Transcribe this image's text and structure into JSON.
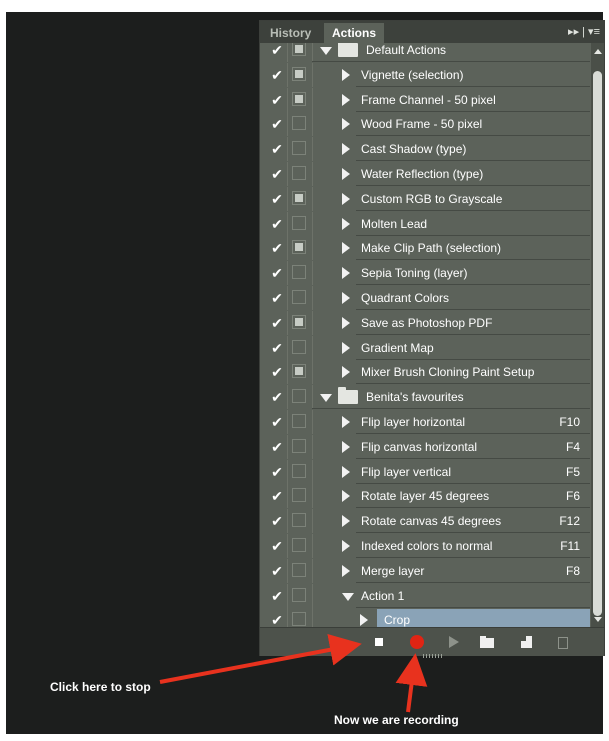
{
  "tabs": [
    {
      "label": "History",
      "active": false
    },
    {
      "label": "Actions",
      "active": true
    }
  ],
  "panel_menu": "▸▸ | ▾≡",
  "rows": [
    {
      "type": "set",
      "label": "Default Actions",
      "dialog": true,
      "expanded": true,
      "key": ""
    },
    {
      "type": "action",
      "label": "Vignette (selection)",
      "dialog": true,
      "key": ""
    },
    {
      "type": "action",
      "label": "Frame Channel - 50 pixel",
      "dialog": true,
      "key": ""
    },
    {
      "type": "action",
      "label": "Wood Frame - 50 pixel",
      "dialog": false,
      "key": ""
    },
    {
      "type": "action",
      "label": "Cast Shadow (type)",
      "dialog": false,
      "key": ""
    },
    {
      "type": "action",
      "label": "Water Reflection (type)",
      "dialog": false,
      "key": ""
    },
    {
      "type": "action",
      "label": "Custom RGB to Grayscale",
      "dialog": true,
      "key": ""
    },
    {
      "type": "action",
      "label": "Molten Lead",
      "dialog": false,
      "key": ""
    },
    {
      "type": "action",
      "label": "Make Clip Path (selection)",
      "dialog": true,
      "key": ""
    },
    {
      "type": "action",
      "label": "Sepia Toning (layer)",
      "dialog": false,
      "key": ""
    },
    {
      "type": "action",
      "label": "Quadrant Colors",
      "dialog": false,
      "key": ""
    },
    {
      "type": "action",
      "label": "Save as Photoshop PDF",
      "dialog": true,
      "key": ""
    },
    {
      "type": "action",
      "label": "Gradient Map",
      "dialog": false,
      "key": ""
    },
    {
      "type": "action",
      "label": "Mixer Brush Cloning Paint Setup",
      "dialog": true,
      "key": ""
    },
    {
      "type": "set",
      "label": "Benita's favourites",
      "dialog": false,
      "expanded": true,
      "key": ""
    },
    {
      "type": "action",
      "label": "Flip layer horizontal",
      "dialog": false,
      "key": "F10"
    },
    {
      "type": "action",
      "label": "Flip canvas horizontal",
      "dialog": false,
      "key": "F4"
    },
    {
      "type": "action",
      "label": "Flip layer vertical",
      "dialog": false,
      "key": "F5"
    },
    {
      "type": "action",
      "label": "Rotate layer 45 degrees",
      "dialog": false,
      "key": "F6"
    },
    {
      "type": "action",
      "label": "Rotate canvas 45 degrees",
      "dialog": false,
      "key": "F12"
    },
    {
      "type": "action",
      "label": "Indexed colors to normal",
      "dialog": false,
      "key": "F11"
    },
    {
      "type": "action",
      "label": "Merge layer",
      "dialog": false,
      "key": "F8"
    },
    {
      "type": "action",
      "label": "Action 1",
      "dialog": false,
      "expanded": true,
      "key": ""
    },
    {
      "type": "step",
      "label": "Crop",
      "dialog": false,
      "key": "",
      "selected": true
    }
  ],
  "toolbar": {
    "buttons": [
      "stop-recording",
      "begin-recording",
      "play-selection",
      "create-new-set",
      "create-new-action",
      "delete"
    ],
    "recording_color": "#e02414"
  },
  "annotations": {
    "stop": "Click here to stop",
    "recording": "Now we are recording",
    "arrow_color": "#e8321e"
  }
}
